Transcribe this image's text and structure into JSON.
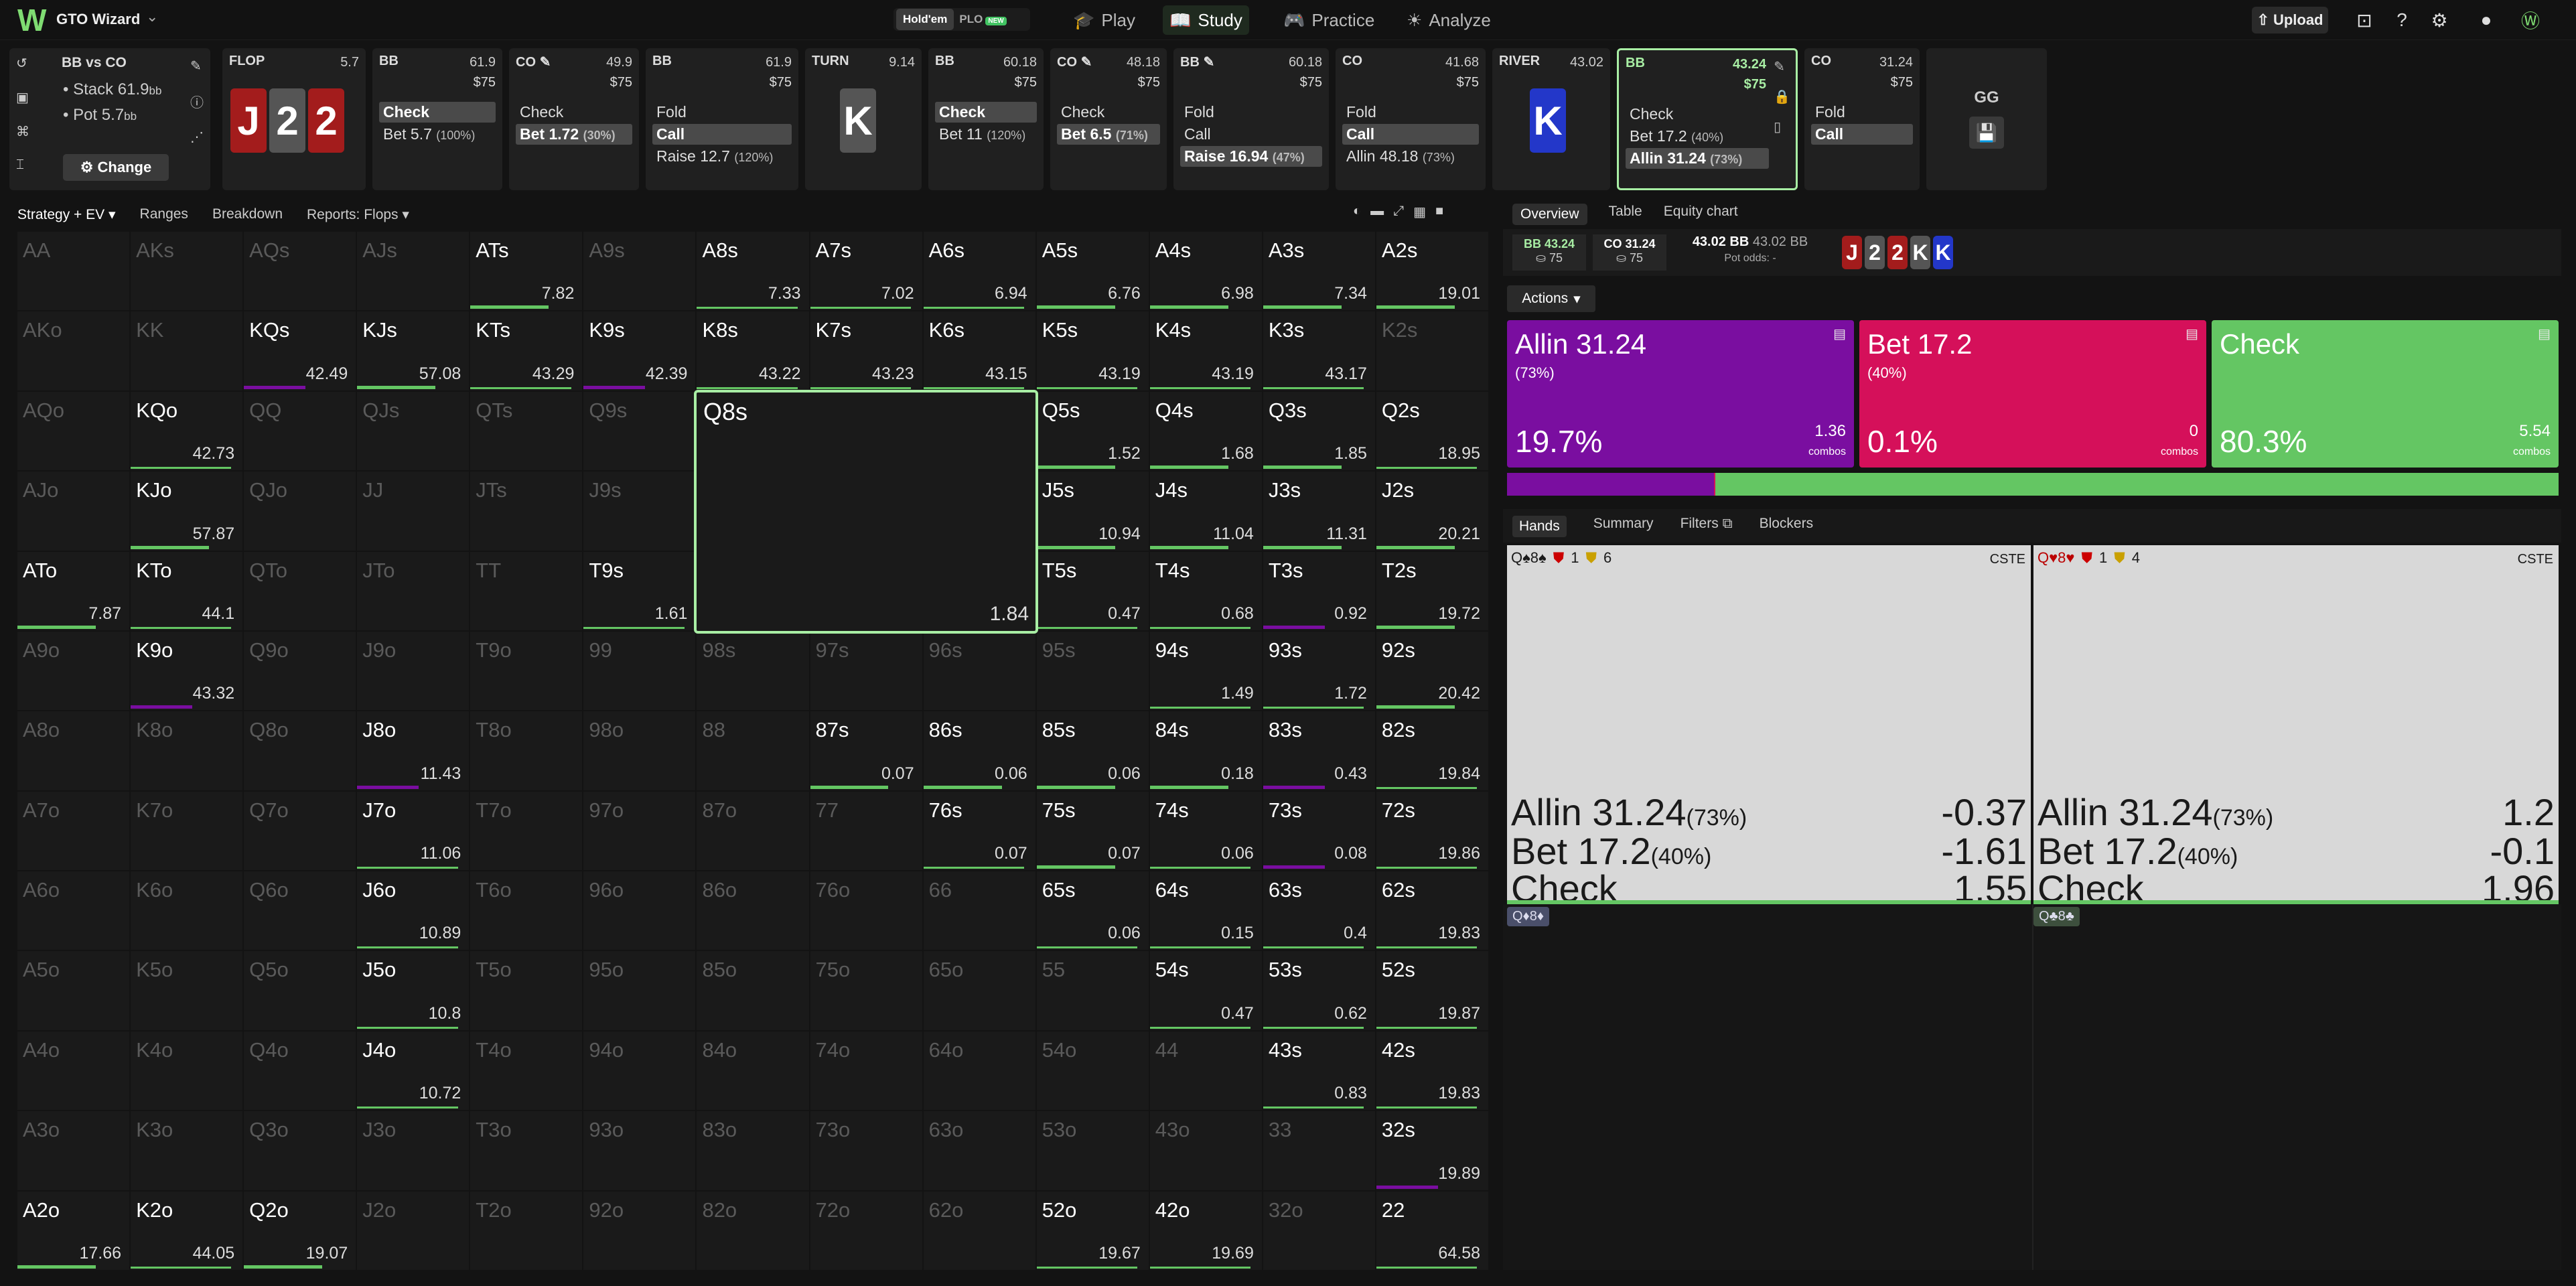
{
  "app": {
    "name": "GTO Wizard"
  },
  "header": {
    "game_options": [
      "Hold'em",
      "PLO"
    ],
    "new_badge": "NEW",
    "nav": [
      {
        "icon": "graduation-cap",
        "label": "Play"
      },
      {
        "icon": "book",
        "label": "Study"
      },
      {
        "icon": "gamepad",
        "label": "Practice"
      },
      {
        "icon": "sun",
        "label": "Analyze"
      }
    ],
    "upload_label": "Upload"
  },
  "spot": {
    "title": "BB vs CO",
    "stack": "Stack 61.9",
    "pot": "Pot 5.7",
    "unit": "bb",
    "change_label": "Change"
  },
  "streets": [
    {
      "name": "FLOP",
      "pot": "5.7",
      "cards": [
        "J",
        "2",
        "2"
      ],
      "colors": [
        "red",
        "gray",
        "red"
      ]
    },
    {
      "name": "TURN",
      "pot": "9.14",
      "cards": [
        "K"
      ],
      "colors": [
        "gray"
      ]
    },
    {
      "name": "RIVER",
      "pot": "43.02",
      "cards": [
        "K"
      ],
      "colors": [
        "blue"
      ]
    }
  ],
  "actions_history": [
    {
      "pos": "BB",
      "stack": "61.9",
      "chips": "$75",
      "acts": [
        {
          "t": "Check",
          "f": "",
          "sel": true
        },
        {
          "t": "Bet 5.7",
          "f": "(100%)",
          "sel": false
        }
      ]
    },
    {
      "pos": "CO",
      "stack": "49.9",
      "chips": "$75",
      "acts": [
        {
          "t": "Check",
          "f": "",
          "sel": false
        },
        {
          "t": "Bet 1.72",
          "f": "(30%)",
          "sel": true
        }
      ]
    },
    {
      "pos": "BB",
      "stack": "61.9",
      "chips": "$75",
      "acts": [
        {
          "t": "Fold",
          "f": "",
          "sel": false
        },
        {
          "t": "Call",
          "f": "",
          "sel": true
        },
        {
          "t": "Raise 12.7",
          "f": "(120%)",
          "sel": false
        }
      ]
    },
    {
      "pos": "BB",
      "stack": "60.18",
      "chips": "$75",
      "acts": [
        {
          "t": "Check",
          "f": "",
          "sel": true
        },
        {
          "t": "Bet 11",
          "f": "(120%)",
          "sel": false
        }
      ]
    },
    {
      "pos": "CO",
      "stack": "48.18",
      "chips": "$75",
      "acts": [
        {
          "t": "Check",
          "f": "",
          "sel": false
        },
        {
          "t": "Bet 6.5",
          "f": "(71%)",
          "sel": true
        }
      ]
    },
    {
      "pos": "BB",
      "stack": "60.18",
      "chips": "$75",
      "acts": [
        {
          "t": "Fold",
          "f": "",
          "sel": false
        },
        {
          "t": "Call",
          "f": "",
          "sel": false
        },
        {
          "t": "Raise 16.94",
          "f": "(47%)",
          "sel": true
        }
      ]
    },
    {
      "pos": "CO",
      "stack": "41.68",
      "chips": "$75",
      "acts": [
        {
          "t": "Fold",
          "f": "",
          "sel": false
        },
        {
          "t": "Call",
          "f": "",
          "sel": true
        },
        {
          "t": "Allin 48.18",
          "f": "(73%)",
          "sel": false
        }
      ]
    },
    {
      "pos": "BB",
      "stack": "43.24",
      "chips": "$75",
      "acts": [
        {
          "t": "Check",
          "f": "",
          "sel": false
        },
        {
          "t": "Bet 17.2",
          "f": "(40%)",
          "sel": false
        },
        {
          "t": "Allin 31.24",
          "f": "(73%)",
          "sel": true
        }
      ]
    },
    {
      "pos": "CO",
      "stack": "31.24",
      "chips": "$75",
      "acts": [
        {
          "t": "Fold",
          "f": "",
          "sel": false
        },
        {
          "t": "Call",
          "f": "",
          "sel": true
        }
      ]
    }
  ],
  "gg_label": "GG",
  "strategy_tabs": [
    "Strategy + EV",
    "Ranges",
    "Breakdown",
    "Reports: Flops"
  ],
  "selected_hand": {
    "name": "Q8s",
    "ev": "1.84"
  },
  "matrix": [
    [
      [
        "AA",
        "",
        1
      ],
      [
        "AKs",
        "",
        1
      ],
      [
        "AQs",
        "",
        1
      ],
      [
        "AJs",
        "",
        1
      ],
      [
        "ATs",
        "7.82",
        0
      ],
      [
        "A9s",
        "",
        1
      ],
      [
        "A8s",
        "7.33",
        0
      ],
      [
        "A7s",
        "7.02",
        0
      ],
      [
        "A6s",
        "6.94",
        0
      ],
      [
        "A5s",
        "6.76",
        0
      ],
      [
        "A4s",
        "6.98",
        0
      ],
      [
        "A3s",
        "7.34",
        0
      ],
      [
        "A2s",
        "19.01",
        0
      ]
    ],
    [
      [
        "AKo",
        "",
        1
      ],
      [
        "KK",
        "",
        1
      ],
      [
        "KQs",
        "42.49",
        0
      ],
      [
        "KJs",
        "57.08",
        0
      ],
      [
        "KTs",
        "43.29",
        0
      ],
      [
        "K9s",
        "42.39",
        0
      ],
      [
        "K8s",
        "43.22",
        0
      ],
      [
        "K7s",
        "43.23",
        0
      ],
      [
        "K6s",
        "43.15",
        0
      ],
      [
        "K5s",
        "43.19",
        0
      ],
      [
        "K4s",
        "43.19",
        0
      ],
      [
        "K3s",
        "43.17",
        0
      ],
      [
        "K2s",
        "",
        1
      ]
    ],
    [
      [
        "AQo",
        "",
        1
      ],
      [
        "KQo",
        "42.73",
        0
      ],
      [
        "QQ",
        "",
        1
      ],
      [
        "QJs",
        "",
        1
      ],
      [
        "QTs",
        "",
        1
      ],
      [
        "Q9s",
        "",
        1
      ],
      [
        "",
        "",
        2
      ],
      [
        "",
        "",
        2
      ],
      [
        "",
        "",
        2
      ],
      [
        "Q5s",
        "1.52",
        0
      ],
      [
        "Q4s",
        "1.68",
        0
      ],
      [
        "Q3s",
        "1.85",
        0
      ],
      [
        "Q2s",
        "18.95",
        0
      ]
    ],
    [
      [
        "AJo",
        "",
        1
      ],
      [
        "KJo",
        "57.87",
        0
      ],
      [
        "QJo",
        "",
        1
      ],
      [
        "JJ",
        "",
        1
      ],
      [
        "JTs",
        "",
        1
      ],
      [
        "J9s",
        "",
        1
      ],
      [
        "",
        "",
        2
      ],
      [
        "",
        "",
        2
      ],
      [
        "",
        "",
        2
      ],
      [
        "J5s",
        "10.94",
        0
      ],
      [
        "J4s",
        "11.04",
        0
      ],
      [
        "J3s",
        "11.31",
        0
      ],
      [
        "J2s",
        "20.21",
        0
      ]
    ],
    [
      [
        "ATo",
        "7.87",
        0
      ],
      [
        "KTo",
        "44.1",
        0
      ],
      [
        "QTo",
        "",
        1
      ],
      [
        "JTo",
        "",
        1
      ],
      [
        "TT",
        "",
        1
      ],
      [
        "T9s",
        "1.61",
        0
      ],
      [
        "",
        "",
        2
      ],
      [
        "",
        "",
        2
      ],
      [
        "",
        "",
        2
      ],
      [
        "T5s",
        "0.47",
        0
      ],
      [
        "T4s",
        "0.68",
        0
      ],
      [
        "T3s",
        "0.92",
        0
      ],
      [
        "T2s",
        "19.72",
        0
      ]
    ],
    [
      [
        "A9o",
        "",
        1
      ],
      [
        "K9o",
        "43.32",
        0
      ],
      [
        "Q9o",
        "",
        1
      ],
      [
        "J9o",
        "",
        1
      ],
      [
        "T9o",
        "",
        1
      ],
      [
        "99",
        "",
        1
      ],
      [
        "98s",
        "",
        1
      ],
      [
        "97s",
        "",
        1
      ],
      [
        "96s",
        "",
        1
      ],
      [
        "95s",
        "",
        1
      ],
      [
        "94s",
        "1.49",
        0
      ],
      [
        "93s",
        "1.72",
        0
      ],
      [
        "92s",
        "20.42",
        0
      ]
    ],
    [
      [
        "A8o",
        "",
        1
      ],
      [
        "K8o",
        "",
        1
      ],
      [
        "Q8o",
        "",
        1
      ],
      [
        "J8o",
        "11.43",
        0
      ],
      [
        "T8o",
        "",
        1
      ],
      [
        "98o",
        "",
        1
      ],
      [
        "88",
        "",
        1
      ],
      [
        "87s",
        "0.07",
        0
      ],
      [
        "86s",
        "0.06",
        0
      ],
      [
        "85s",
        "0.06",
        0
      ],
      [
        "84s",
        "0.18",
        0
      ],
      [
        "83s",
        "0.43",
        0
      ],
      [
        "82s",
        "19.84",
        0
      ]
    ],
    [
      [
        "A7o",
        "",
        1
      ],
      [
        "K7o",
        "",
        1
      ],
      [
        "Q7o",
        "",
        1
      ],
      [
        "J7o",
        "11.06",
        0
      ],
      [
        "T7o",
        "",
        1
      ],
      [
        "97o",
        "",
        1
      ],
      [
        "87o",
        "",
        1
      ],
      [
        "77",
        "",
        1
      ],
      [
        "76s",
        "0.07",
        0
      ],
      [
        "75s",
        "0.07",
        0
      ],
      [
        "74s",
        "0.06",
        0
      ],
      [
        "73s",
        "0.08",
        0
      ],
      [
        "72s",
        "19.86",
        0
      ]
    ],
    [
      [
        "A6o",
        "",
        1
      ],
      [
        "K6o",
        "",
        1
      ],
      [
        "Q6o",
        "",
        1
      ],
      [
        "J6o",
        "10.89",
        0
      ],
      [
        "T6o",
        "",
        1
      ],
      [
        "96o",
        "",
        1
      ],
      [
        "86o",
        "",
        1
      ],
      [
        "76o",
        "",
        1
      ],
      [
        "66",
        "",
        1
      ],
      [
        "65s",
        "0.06",
        0
      ],
      [
        "64s",
        "0.15",
        0
      ],
      [
        "63s",
        "0.4",
        0
      ],
      [
        "62s",
        "19.83",
        0
      ]
    ],
    [
      [
        "A5o",
        "",
        1
      ],
      [
        "K5o",
        "",
        1
      ],
      [
        "Q5o",
        "",
        1
      ],
      [
        "J5o",
        "10.8",
        0
      ],
      [
        "T5o",
        "",
        1
      ],
      [
        "95o",
        "",
        1
      ],
      [
        "85o",
        "",
        1
      ],
      [
        "75o",
        "",
        1
      ],
      [
        "65o",
        "",
        1
      ],
      [
        "55",
        "",
        1
      ],
      [
        "54s",
        "0.47",
        0
      ],
      [
        "53s",
        "0.62",
        0
      ],
      [
        "52s",
        "19.87",
        0
      ]
    ],
    [
      [
        "A4o",
        "",
        1
      ],
      [
        "K4o",
        "",
        1
      ],
      [
        "Q4o",
        "",
        1
      ],
      [
        "J4o",
        "10.72",
        0
      ],
      [
        "T4o",
        "",
        1
      ],
      [
        "94o",
        "",
        1
      ],
      [
        "84o",
        "",
        1
      ],
      [
        "74o",
        "",
        1
      ],
      [
        "64o",
        "",
        1
      ],
      [
        "54o",
        "",
        1
      ],
      [
        "44",
        "",
        1
      ],
      [
        "43s",
        "0.83",
        0
      ],
      [
        "42s",
        "19.83",
        0
      ]
    ],
    [
      [
        "A3o",
        "",
        1
      ],
      [
        "K3o",
        "",
        1
      ],
      [
        "Q3o",
        "",
        1
      ],
      [
        "J3o",
        "",
        1
      ],
      [
        "T3o",
        "",
        1
      ],
      [
        "93o",
        "",
        1
      ],
      [
        "83o",
        "",
        1
      ],
      [
        "73o",
        "",
        1
      ],
      [
        "63o",
        "",
        1
      ],
      [
        "53o",
        "",
        1
      ],
      [
        "43o",
        "",
        1
      ],
      [
        "33",
        "",
        1
      ],
      [
        "32s",
        "19.89",
        0
      ]
    ],
    [
      [
        "A2o",
        "17.66",
        0
      ],
      [
        "K2o",
        "44.05",
        0
      ],
      [
        "Q2o",
        "19.07",
        0
      ],
      [
        "J2o",
        "",
        1
      ],
      [
        "T2o",
        "",
        1
      ],
      [
        "92o",
        "",
        1
      ],
      [
        "82o",
        "",
        1
      ],
      [
        "72o",
        "",
        1
      ],
      [
        "62o",
        "",
        1
      ],
      [
        "52o",
        "19.67",
        0
      ],
      [
        "42o",
        "19.69",
        0
      ],
      [
        "32o",
        "",
        1
      ],
      [
        "22",
        "64.58",
        0
      ]
    ]
  ],
  "right_tabs": [
    "Overview",
    "Table",
    "Equity chart"
  ],
  "overview": {
    "bb": {
      "label": "BB 43.24",
      "chips": "75"
    },
    "co": {
      "label": "CO 31.24",
      "chips": "75"
    },
    "pot": {
      "label": "43.02 BB",
      "label2": "43.02 BB",
      "odds": "Pot odds: -"
    },
    "board": [
      "J",
      "2",
      "2",
      "K",
      "K"
    ]
  },
  "actions_label": "Actions",
  "action_boxes": [
    {
      "title": "Allin 31.24",
      "freq": "(73%)",
      "pct": "19.7%",
      "combos": "1.36",
      "color": "#7a0ea0"
    },
    {
      "title": "Bet 17.2",
      "freq": "(40%)",
      "pct": "0.1%",
      "combos": "0",
      "color": "#d5105a"
    },
    {
      "title": "Check",
      "freq": "",
      "pct": "80.3%",
      "combos": "5.54",
      "color": "#64c663"
    }
  ],
  "combos_label": "combos",
  "freq_bar": {
    "allin_pct": 19.7,
    "bet_pct": 0.1,
    "check_pct": 80.3
  },
  "hands_tabs": [
    "Hands",
    "Summary",
    "Filters",
    "Blockers"
  ],
  "hand_details": [
    {
      "combo": "Q♠8♠",
      "hero": "1",
      "villain": "6",
      "tag": "CSTE",
      "rows": [
        {
          "a": "Allin 31.24",
          "f": "(73%)",
          "v": "-0.37"
        },
        {
          "a": "Bet 17.2",
          "f": "(40%)",
          "v": "-1.61"
        },
        {
          "a": "Check",
          "f": "",
          "v": "1.55"
        }
      ],
      "chip": "Q♦8♦"
    },
    {
      "combo": "Q♥8♥",
      "hero": "1",
      "villain": "4",
      "tag": "CSTE",
      "rows": [
        {
          "a": "Allin 31.24",
          "f": "(73%)",
          "v": "1.2"
        },
        {
          "a": "Bet 17.2",
          "f": "(40%)",
          "v": "-0.1"
        },
        {
          "a": "Check",
          "f": "",
          "v": "1.96"
        }
      ],
      "chip": "Q♣8♣"
    }
  ],
  "colors": {
    "green": "#64c663",
    "purple": "#7a0ea0",
    "pink": "#d5105a",
    "selected_outline": "#a8eea4"
  }
}
